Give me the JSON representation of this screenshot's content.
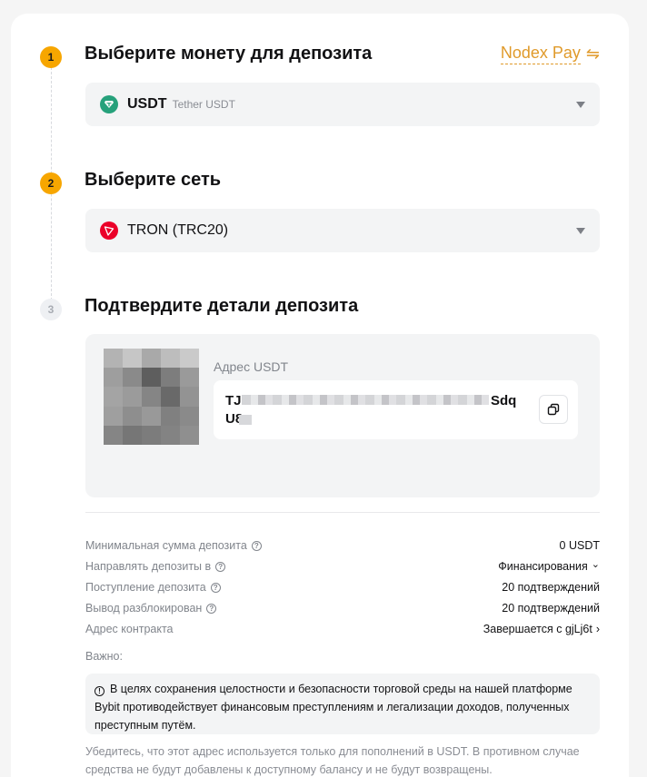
{
  "steps": [
    {
      "num": "1",
      "title": "Выберите монету для депозита"
    },
    {
      "num": "2",
      "title": "Выберите сеть"
    },
    {
      "num": "3",
      "title": "Подтвердите детали депозита"
    }
  ],
  "nodex": {
    "label": "Nodex Pay",
    "icon": "⇋"
  },
  "coin_select": {
    "symbol": "USDT",
    "name": "Tether USDT",
    "icon": "tether-icon",
    "color": "#26a17b"
  },
  "network_select": {
    "label": "TRON (TRC20)",
    "icon": "tron-icon",
    "color": "#eb0029"
  },
  "deposit": {
    "address_label": "Адрес USDT",
    "address_line1_start": "TJ",
    "address_line1_end": "Sdq",
    "address_line2_start": "U8"
  },
  "details": [
    {
      "key": "Минимальная сумма депозита",
      "value": "0 USDT",
      "help": true,
      "chevron": ""
    },
    {
      "key": "Направлять депозиты в",
      "value": "Финансирования",
      "help": true,
      "chevron": "⌄"
    },
    {
      "key": "Поступление депозита",
      "value": "20 подтверждений",
      "help": true,
      "chevron": ""
    },
    {
      "key": "Вывод разблокирован",
      "value": "20 подтверждений",
      "help": true,
      "chevron": ""
    },
    {
      "key": "Адрес контракта",
      "value": "Завершается с gjLj6t",
      "help": false,
      "chevron": "›"
    }
  ],
  "important_title": "Важно:",
  "notice_text": "В целях сохранения целостности и безопасности торговой среды на нашей платформе Bybit противодействует финансовым преступлениям и легализации доходов, полученных преступным путём.",
  "footer_text": "Убедитесь, что этот адрес используется только для пополнений в USDT. В противном случае средства не будут добавлены к доступному балансу и не будут возвращены.",
  "colors": {
    "accent": "#f7a600",
    "link": "#e09a2a"
  }
}
